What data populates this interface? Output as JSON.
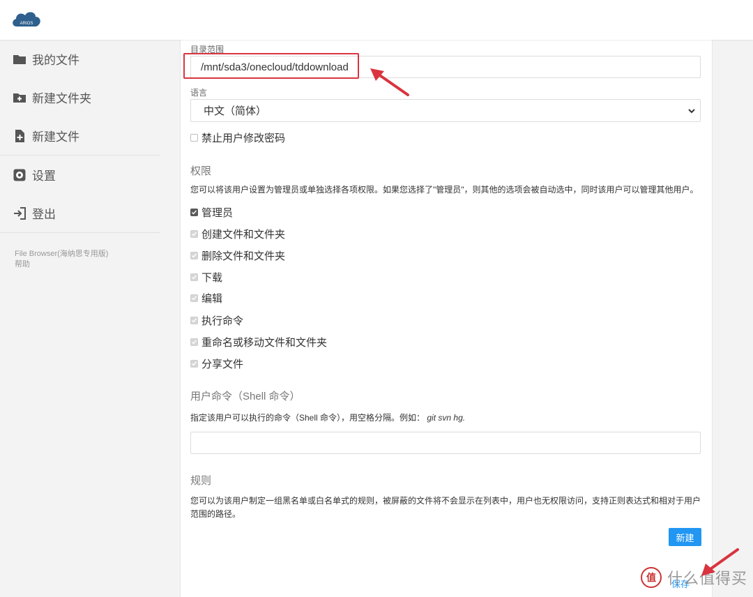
{
  "header": {
    "logo_text": "ARIOS"
  },
  "sidebar": {
    "items": [
      {
        "label": "我的文件",
        "icon": "folder-icon"
      },
      {
        "label": "新建文件夹",
        "icon": "folder-plus-icon"
      },
      {
        "label": "新建文件",
        "icon": "file-plus-icon"
      },
      {
        "label": "设置",
        "icon": "gear-icon"
      },
      {
        "label": "登出",
        "icon": "logout-icon"
      }
    ],
    "credits": {
      "app_name": "File Browser(海纳思专用版)",
      "help": "帮助"
    }
  },
  "form": {
    "scope": {
      "label": "目录范围",
      "value": "/mnt/sda3/onecloud/tddownload"
    },
    "language": {
      "label": "语言",
      "selected": "中文（简体）"
    },
    "lock_password": {
      "label": "禁止用户修改密码",
      "checked": false
    },
    "permissions": {
      "title": "权限",
      "description": "您可以将该用户设置为管理员或单独选择各项权限。如果您选择了\"管理员\"，则其他的选项会被自动选中，同时该用户可以管理其他用户。",
      "items": [
        {
          "label": "管理员",
          "checked": true,
          "disabled": false
        },
        {
          "label": "创建文件和文件夹",
          "checked": true,
          "disabled": true
        },
        {
          "label": "删除文件和文件夹",
          "checked": true,
          "disabled": true
        },
        {
          "label": "下载",
          "checked": true,
          "disabled": true
        },
        {
          "label": "编辑",
          "checked": true,
          "disabled": true
        },
        {
          "label": "执行命令",
          "checked": true,
          "disabled": true
        },
        {
          "label": "重命名或移动文件和文件夹",
          "checked": true,
          "disabled": true
        },
        {
          "label": "分享文件",
          "checked": true,
          "disabled": true
        }
      ]
    },
    "commands": {
      "title": "用户命令（Shell 命令）",
      "description_prefix": "指定该用户可以执行的命令（Shell 命令），用空格分隔。例如：",
      "description_example": "git svn hg.",
      "value": ""
    },
    "rules": {
      "title": "规则",
      "description": "您可以为该用户制定一组黑名单或白名单式的规则，被屏蔽的文件将不会显示在列表中，用户也无权限访问，支持正则表达式和相对于用户范围的路径。",
      "new_button": "新建"
    },
    "save_button": "保存"
  },
  "watermark": {
    "badge": "值",
    "text": "什么值得买"
  },
  "colors": {
    "accent": "#2196f3",
    "annotation": "#d9343f"
  }
}
